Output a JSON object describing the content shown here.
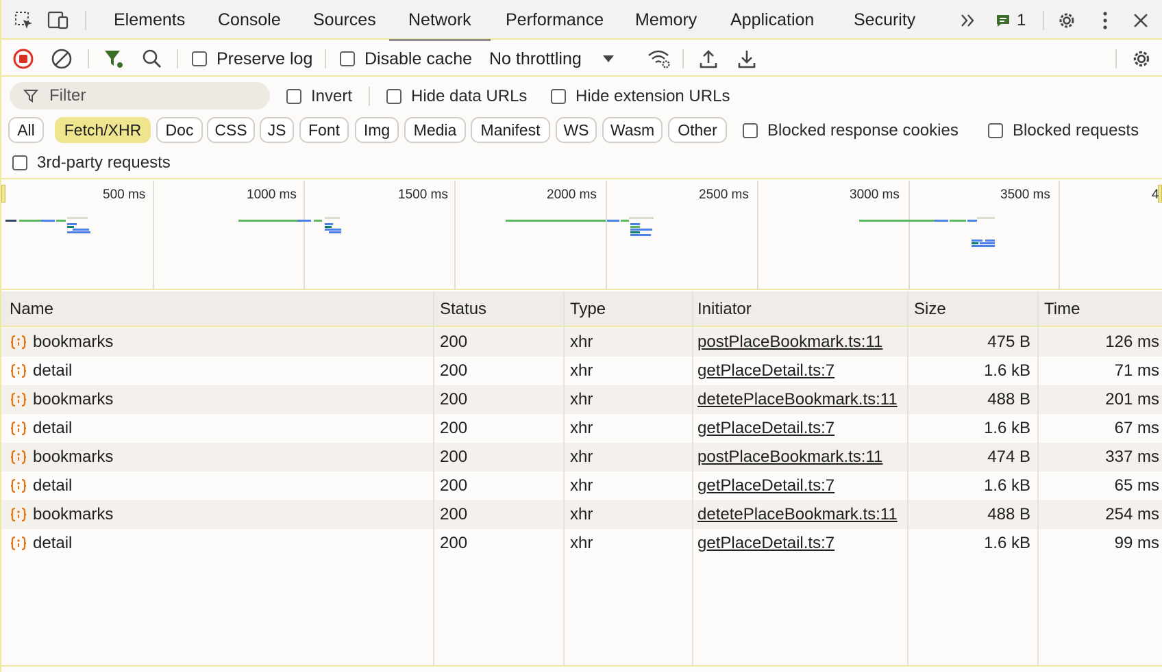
{
  "tabs": {
    "items": [
      "Elements",
      "Console",
      "Sources",
      "Network",
      "Performance",
      "Memory",
      "Application",
      "Security"
    ],
    "active": "Network",
    "more": "»",
    "issues_count": "1"
  },
  "toolbar": {
    "preserve_log": "Preserve log",
    "disable_cache": "Disable cache",
    "throttling": "No throttling"
  },
  "filter": {
    "placeholder": "Filter",
    "invert": "Invert",
    "hide_data_urls": "Hide data URLs",
    "hide_extension_urls": "Hide extension URLs",
    "types": [
      "All",
      "Fetch/XHR",
      "Doc",
      "CSS",
      "JS",
      "Font",
      "Img",
      "Media",
      "Manifest",
      "WS",
      "Wasm",
      "Other"
    ],
    "active_type": "Fetch/XHR",
    "blocked_response_cookies": "Blocked response cookies",
    "blocked_requests": "Blocked requests",
    "third_party": "3rd-party requests"
  },
  "timeline": {
    "ticks": [
      "500 ms",
      "1000 ms",
      "1500 ms",
      "2000 ms",
      "2500 ms",
      "3000 ms",
      "3500 ms",
      "4"
    ]
  },
  "table": {
    "columns": [
      "Name",
      "Status",
      "Type",
      "Initiator",
      "Size",
      "Time"
    ],
    "rows": [
      {
        "name": "bookmarks",
        "status": "200",
        "type": "xhr",
        "initiator": "postPlaceBookmark.ts:11",
        "size": "475 B",
        "time": "126 ms"
      },
      {
        "name": "detail",
        "status": "200",
        "type": "xhr",
        "initiator": "getPlaceDetail.ts:7",
        "size": "1.6 kB",
        "time": "71 ms"
      },
      {
        "name": "bookmarks",
        "status": "200",
        "type": "xhr",
        "initiator": "detetePlaceBookmark.ts:11",
        "size": "488 B",
        "time": "201 ms"
      },
      {
        "name": "detail",
        "status": "200",
        "type": "xhr",
        "initiator": "getPlaceDetail.ts:7",
        "size": "1.6 kB",
        "time": "67 ms"
      },
      {
        "name": "bookmarks",
        "status": "200",
        "type": "xhr",
        "initiator": "postPlaceBookmark.ts:11",
        "size": "474 B",
        "time": "337 ms"
      },
      {
        "name": "detail",
        "status": "200",
        "type": "xhr",
        "initiator": "getPlaceDetail.ts:7",
        "size": "1.6 kB",
        "time": "65 ms"
      },
      {
        "name": "bookmarks",
        "status": "200",
        "type": "xhr",
        "initiator": "detetePlaceBookmark.ts:11",
        "size": "488 B",
        "time": "254 ms"
      },
      {
        "name": "detail",
        "status": "200",
        "type": "xhr",
        "initiator": "getPlaceDetail.ts:7",
        "size": "1.6 kB",
        "time": "99 ms"
      }
    ]
  },
  "colors": {
    "accent_yellow": "#f0e58f",
    "record_red": "#d93025",
    "xhr_orange": "#e8710a",
    "bar_green": "#5cb85c",
    "bar_blue": "#4a80e8"
  }
}
